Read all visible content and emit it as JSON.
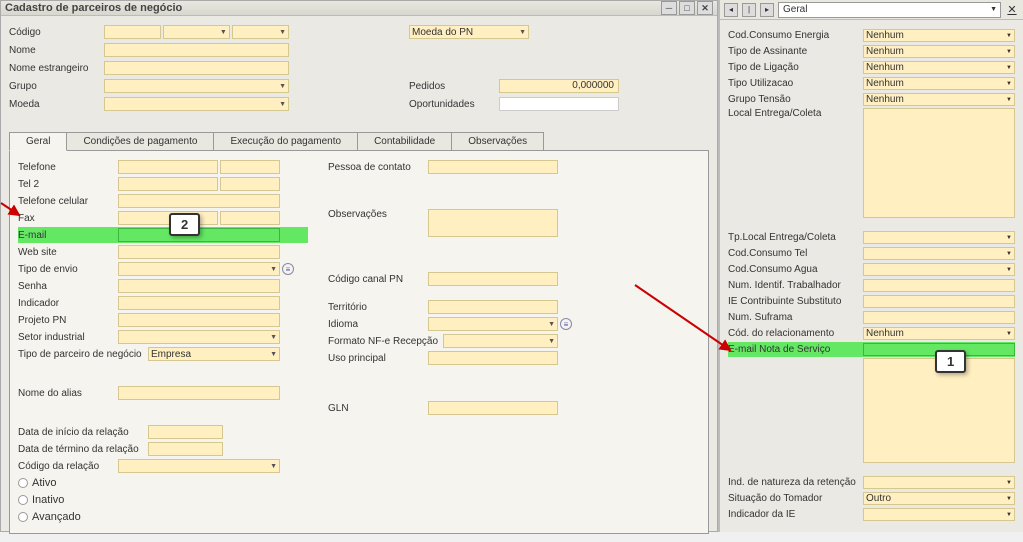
{
  "window": {
    "title": "Cadastro de parceiros de negócio"
  },
  "header": {
    "codigo": "Código",
    "nome": "Nome",
    "nome_estrangeiro": "Nome estrangeiro",
    "grupo": "Grupo",
    "moeda": "Moeda",
    "moeda_pn": "Moeda do PN",
    "pedidos": "Pedidos",
    "pedidos_val": "0,000000",
    "oportunidades": "Oportunidades"
  },
  "tabs": {
    "geral": "Geral",
    "condicoes": "Condições de pagamento",
    "execucao": "Execução do pagamento",
    "contabilidade": "Contabilidade",
    "observacoes": "Observações"
  },
  "geral": {
    "telefone": "Telefone",
    "tel2": "Tel 2",
    "tel_celular": "Telefone celular",
    "fax": "Fax",
    "email": "E-mail",
    "website": "Web site",
    "tipo_envio": "Tipo de envio",
    "senha": "Senha",
    "indicador": "Indicador",
    "projeto_pn": "Projeto PN",
    "setor_industrial": "Setor industrial",
    "tipo_parceiro": "Tipo de parceiro de negócio",
    "tipo_parceiro_val": "Empresa",
    "nome_alias": "Nome do alias",
    "data_inicio": "Data de início da relação",
    "data_termino": "Data de término da relação",
    "codigo_relacao": "Código da relação",
    "ativo": "Ativo",
    "inativo": "Inativo",
    "avancado": "Avançado",
    "pessoa_contato": "Pessoa de contato",
    "observacoes": "Observações",
    "codigo_canal": "Código canal PN",
    "territorio": "Território",
    "idioma": "Idioma",
    "formato_nfe": "Formato NF-e Recepção",
    "uso_principal": "Uso principal",
    "gln": "GLN"
  },
  "side": {
    "header_dd": "Geral",
    "cod_consumo_energia": "Cod.Consumo Energia",
    "tipo_assinante": "Tipo de Assinante",
    "tipo_ligacao": "Tipo de Ligação",
    "tipo_utilizacao": "Tipo Utilizacao",
    "grupo_tensao": "Grupo Tensão",
    "local_entrega": "Local Entrega/Coleta",
    "tp_local": "Tp.Local Entrega/Coleta",
    "cod_consumo_tel": "Cod.Consumo Tel",
    "cod_consumo_agua": "Cod.Consumo Agua",
    "num_identif": "Num. Identif. Trabalhador",
    "ie_contribuinte": "IE Contribuinte Substituto",
    "num_suframa": "Num. Suframa",
    "cod_relacionamento": "Cód. do relacionamento",
    "email_nota": "E-mail Nota de Serviço",
    "ind_natureza": "Ind. de natureza da retenção",
    "situacao_tomador": "Situação do Tomador",
    "indicador_ie": "Indicador da IE",
    "nenhum": "Nenhum",
    "outro": "Outro"
  },
  "callouts": {
    "c1": "1",
    "c2": "2"
  }
}
